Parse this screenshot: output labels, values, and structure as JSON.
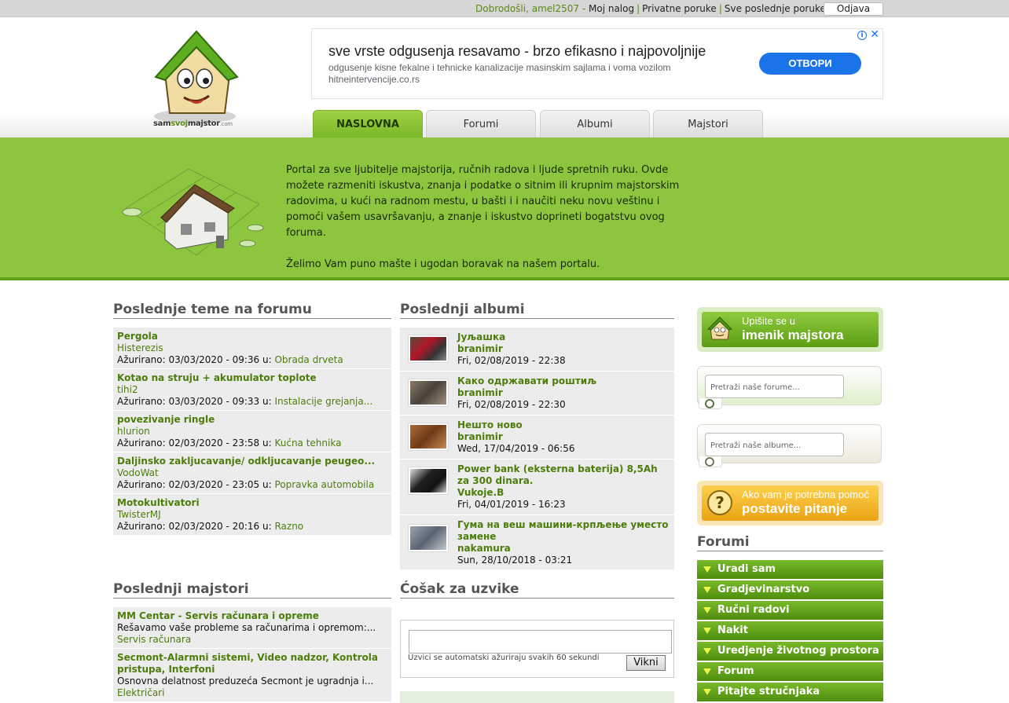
{
  "topbar": {
    "welcome": "Dobrodošli, amel2507 -",
    "links": [
      "Moj nalog",
      "Privatne poruke",
      "Sve poslednje poruke"
    ],
    "logout": "Odjava"
  },
  "logo": {
    "part1": "sam",
    "part2": "svoj",
    "part3": "majstor",
    "part4": ".com"
  },
  "ad": {
    "title": "sve vrste odgusenja resavamo - brzo efikasno i najpovoljnije",
    "description": "odgusenje kisne fekalne i tehnicke kanalizacije masinskim sajlama i voma vozilom",
    "url": "hitneintervencije.co.rs",
    "button": "ОТВОРИ",
    "info": "i",
    "close": "✕"
  },
  "tabs": [
    {
      "label": "NASLOVNA",
      "active": true
    },
    {
      "label": "Forumi",
      "active": false
    },
    {
      "label": "Albumi",
      "active": false
    },
    {
      "label": "Majstori",
      "active": false
    }
  ],
  "banner": {
    "text1": "Portal za sve ljubitelje majstorija, ručnih radova i ljude spretnih ruku. Ovde možete razmeniti iskustva, znanja i podatke o sitnim ili krupnim majstorskim radovima, u kući na radnom mestu, u bašti i i naučiti neku novu veštinu i pomoći vašem usavršavanju, a znanje i iskustvo doprineti bogatstvu ovog foruma.",
    "text2": "Želimo Vam puno mašte i ugodan boravak na našem portalu."
  },
  "latest_topics": {
    "title": "Poslednje teme na forumu",
    "items": [
      {
        "title": "Pergola",
        "user": "Histerezis",
        "updated": "Ažurirano: 03/03/2020 - 09:36 u:",
        "category": "Obrada drveta"
      },
      {
        "title": "Kotao na struju + akumulator toplote",
        "user": "tihi2",
        "updated": "Ažurirano: 03/03/2020 - 09:33 u:",
        "category": "Instalacije grejanja..."
      },
      {
        "title": "povezivanje ringle",
        "user": "hlurion",
        "updated": "Ažurirano: 02/03/2020 - 23:58 u:",
        "category": "Kućna tehnika"
      },
      {
        "title": "Daljinsko zakljucavanje/ odkljucavanje peugeo...",
        "user": "VodoWat",
        "updated": "Ažurirano: 02/03/2020 - 23:05 u:",
        "category": "Popravka automobila"
      },
      {
        "title": "Motokultivatori",
        "user": "TwisterMJ",
        "updated": "Ažurirano: 02/03/2020 - 20:16 u:",
        "category": "Razno"
      }
    ]
  },
  "latest_albums": {
    "title": "Poslednji albumi",
    "items": [
      {
        "title": "Јуљашка",
        "user": "branimir",
        "date": "Fri, 02/08/2019 - 22:38"
      },
      {
        "title": "Како одржавати роштиљ",
        "user": "branimir",
        "date": "Fri, 02/08/2019 - 22:30"
      },
      {
        "title": "Нешто ново",
        "user": "branimir",
        "date": "Wed, 17/04/2019 - 06:56"
      },
      {
        "title": "Power bank (eksterna baterija) 8,5Ah za 300 dinara.",
        "user": "Vukoje.B",
        "date": "Fri, 04/01/2019 - 16:23"
      },
      {
        "title": "Гума на веш машини-крпљење уместо замене",
        "user": "nakamura",
        "date": "Sun, 28/10/2018 - 03:21"
      }
    ]
  },
  "latest_craftsmen": {
    "title": "Poslednji majstori",
    "items": [
      {
        "title": "MM Centar - Servis računara i opreme",
        "desc": "Rešavamo vaše probleme sa računarima i opremom:...",
        "category": "Servis računara"
      },
      {
        "title": "Secmont-Alarmni sistemi, Video nadzor, Kontrola pristupa, Interfoni",
        "desc": "Osnovna delatnost preduzeća Secmont je ugradnja i...",
        "category": "Električari"
      }
    ]
  },
  "shoutbox": {
    "title": "Ćošak za uzvike",
    "note": "Uzvici se automatski ažuriraju svakih 60 sekundi",
    "button": "Vikni"
  },
  "sidebar": {
    "promo_register": {
      "small": "Upišite se u",
      "big": "imenik majstora"
    },
    "search_forums_placeholder": "Pretraži naše forume...",
    "search_albums_placeholder": "Pretraži naše albume...",
    "promo_ask": {
      "small": "Ako vam je potrebna pomoć",
      "big": "postavite pitanje"
    },
    "forums_title": "Forumi",
    "forums": [
      "Uradi sam",
      "Gradjevinarstvo",
      "Ručni radovi",
      "Nakit",
      "Uredjenje životnog prostora",
      "Forum",
      "Pitajte stručnjaka"
    ]
  },
  "colors": {
    "green": "#8cc63f",
    "dark_green": "#4c7d0b",
    "accent_blue": "#1a73e8"
  }
}
